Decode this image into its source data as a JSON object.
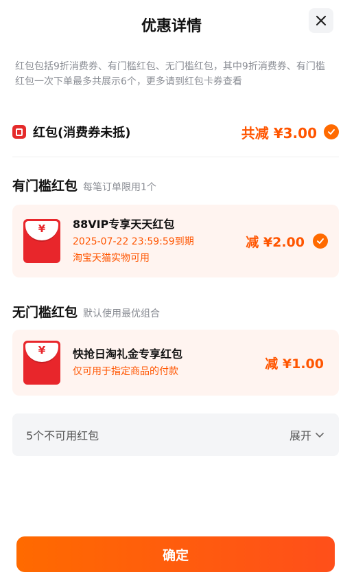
{
  "header": {
    "title": "优惠详情"
  },
  "description": "红包包括9折消费券、有门槛红包、无门槛红包，其中9折消费券、有门槛红包一次下单最多共展示6个，更多请到红包卡券查看",
  "total": {
    "label": "红包(消费券未抵)",
    "amount": "共减 ¥3.00"
  },
  "threshold": {
    "title": "有门槛红包",
    "note": "每笔订单限用1个",
    "card": {
      "name": "88VIP专享天天红包",
      "expiry": "2025-07-22 23:59:59到期",
      "scope": "淘宝天猫实物可用",
      "amount": "减 ¥2.00",
      "icon_symbol": "¥"
    }
  },
  "no_threshold": {
    "title": "无门槛红包",
    "note": "默认使用最优组合",
    "card": {
      "name": "快抢日淘礼金专享红包",
      "scope": "仅可用于指定商品的付款",
      "amount": "减 ¥1.00",
      "icon_symbol": "¥"
    }
  },
  "unavailable": {
    "label": "5个不可用红包",
    "expand": "展开"
  },
  "confirm_label": "确定",
  "colors": {
    "accent": "#ff5500",
    "packet_red": "#e8262b",
    "card_bg": "#fff4f0"
  }
}
